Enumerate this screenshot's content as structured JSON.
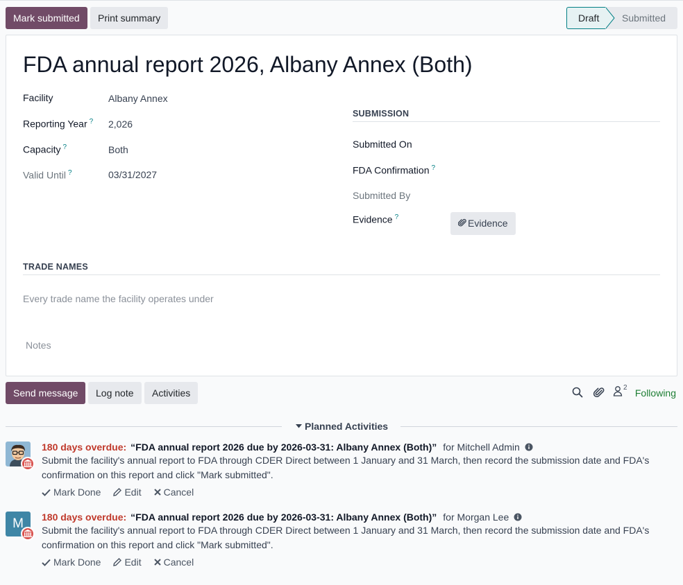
{
  "toolbar": {
    "mark_submitted": "Mark submitted",
    "print_summary": "Print summary"
  },
  "statusbar": {
    "steps": [
      "Draft",
      "Submitted"
    ],
    "active": "Draft"
  },
  "record": {
    "title": "FDA annual report 2026, Albany Annex (Both)",
    "fields": {
      "facility": {
        "label": "Facility",
        "value": "Albany Annex"
      },
      "reporting_year": {
        "label": "Reporting Year",
        "value": "2,026",
        "help": "?"
      },
      "capacity": {
        "label": "Capacity",
        "value": "Both",
        "help": "?"
      },
      "valid_until": {
        "label": "Valid Until",
        "value": "03/31/2027",
        "help": "?"
      }
    },
    "submission": {
      "heading": "SUBMISSION",
      "submitted_on": "Submitted On",
      "fda_confirmation": "FDA Confirmation",
      "submitted_by": "Submitted By",
      "evidence": "Evidence",
      "evidence_button": "Evidence"
    },
    "trade_names": {
      "heading": "TRADE NAMES",
      "placeholder": "Every trade name the facility operates under"
    },
    "notes_placeholder": "Notes"
  },
  "chatter": {
    "send_message": "Send message",
    "log_note": "Log note",
    "activities": "Activities",
    "follower_count": "2",
    "following": "Following",
    "planned_heading": "Planned Activities"
  },
  "activities": [
    {
      "overdue": "180 days overdue:",
      "title": "“FDA annual report 2026 due by 2026-03-31: Albany Annex (Both)”",
      "assignee": "for Mitchell Admin",
      "body": "Submit the facility's annual report to FDA through CDER Direct between 1 January and 31 March, then record the submission date and FDA's confirmation on this report and click \"Mark submitted\".",
      "avatar_letter": "",
      "actions": {
        "done": "Mark Done",
        "edit": "Edit",
        "cancel": "Cancel"
      }
    },
    {
      "overdue": "180 days overdue:",
      "title": "“FDA annual report 2026 due by 2026-03-31: Albany Annex (Both)”",
      "assignee": "for Morgan Lee",
      "body": "Submit the facility's annual report to FDA through CDER Direct between 1 January and 31 March, then record the submission date and FDA's confirmation on this report and click \"Mark submitted\".",
      "avatar_letter": "M",
      "actions": {
        "done": "Mark Done",
        "edit": "Edit",
        "cancel": "Cancel"
      }
    }
  ],
  "colors": {
    "primary": "#714b67",
    "accent": "#017e84",
    "overdue": "#c0392b",
    "following": "#1e7e34"
  }
}
